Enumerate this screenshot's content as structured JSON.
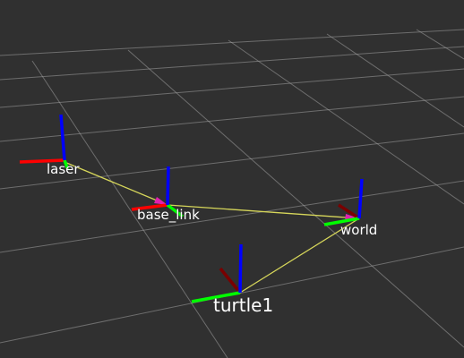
{
  "view": {
    "background": "#303030",
    "grid_color": "#a0a0a0",
    "axis_colors": {
      "x": "#ff0000",
      "y": "#00ff00",
      "z": "#0000ff"
    },
    "link_color": "#d6d65a"
  },
  "frames": [
    {
      "id": "laser",
      "label": "laser"
    },
    {
      "id": "base_link",
      "label": "base_link"
    },
    {
      "id": "world",
      "label": "world"
    },
    {
      "id": "turtle1",
      "label": "turtle1"
    }
  ],
  "links": [
    {
      "from": "laser",
      "to": "base_link"
    },
    {
      "from": "base_link",
      "to": "world"
    },
    {
      "from": "turtle1",
      "to": "world"
    }
  ]
}
